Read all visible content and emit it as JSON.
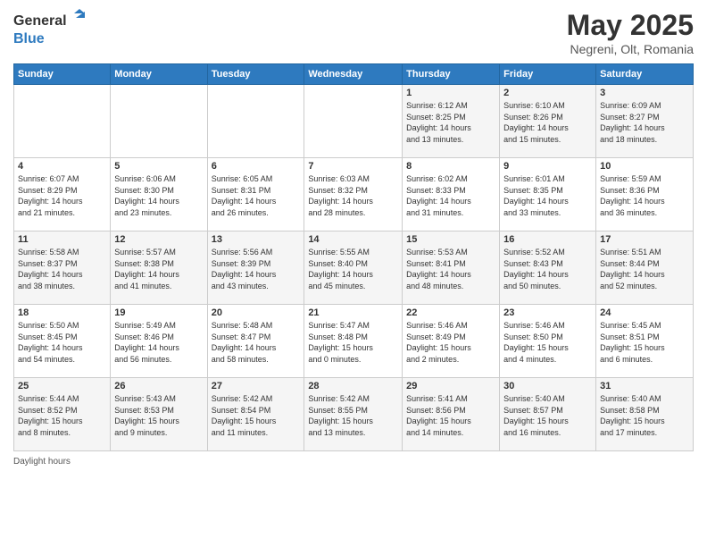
{
  "header": {
    "logo_line1": "General",
    "logo_line2": "Blue",
    "month_title": "May 2025",
    "location": "Negreni, Olt, Romania"
  },
  "days_of_week": [
    "Sunday",
    "Monday",
    "Tuesday",
    "Wednesday",
    "Thursday",
    "Friday",
    "Saturday"
  ],
  "weeks": [
    [
      {
        "day": "",
        "info": ""
      },
      {
        "day": "",
        "info": ""
      },
      {
        "day": "",
        "info": ""
      },
      {
        "day": "",
        "info": ""
      },
      {
        "day": "1",
        "info": "Sunrise: 6:12 AM\nSunset: 8:25 PM\nDaylight: 14 hours\nand 13 minutes."
      },
      {
        "day": "2",
        "info": "Sunrise: 6:10 AM\nSunset: 8:26 PM\nDaylight: 14 hours\nand 15 minutes."
      },
      {
        "day": "3",
        "info": "Sunrise: 6:09 AM\nSunset: 8:27 PM\nDaylight: 14 hours\nand 18 minutes."
      }
    ],
    [
      {
        "day": "4",
        "info": "Sunrise: 6:07 AM\nSunset: 8:29 PM\nDaylight: 14 hours\nand 21 minutes."
      },
      {
        "day": "5",
        "info": "Sunrise: 6:06 AM\nSunset: 8:30 PM\nDaylight: 14 hours\nand 23 minutes."
      },
      {
        "day": "6",
        "info": "Sunrise: 6:05 AM\nSunset: 8:31 PM\nDaylight: 14 hours\nand 26 minutes."
      },
      {
        "day": "7",
        "info": "Sunrise: 6:03 AM\nSunset: 8:32 PM\nDaylight: 14 hours\nand 28 minutes."
      },
      {
        "day": "8",
        "info": "Sunrise: 6:02 AM\nSunset: 8:33 PM\nDaylight: 14 hours\nand 31 minutes."
      },
      {
        "day": "9",
        "info": "Sunrise: 6:01 AM\nSunset: 8:35 PM\nDaylight: 14 hours\nand 33 minutes."
      },
      {
        "day": "10",
        "info": "Sunrise: 5:59 AM\nSunset: 8:36 PM\nDaylight: 14 hours\nand 36 minutes."
      }
    ],
    [
      {
        "day": "11",
        "info": "Sunrise: 5:58 AM\nSunset: 8:37 PM\nDaylight: 14 hours\nand 38 minutes."
      },
      {
        "day": "12",
        "info": "Sunrise: 5:57 AM\nSunset: 8:38 PM\nDaylight: 14 hours\nand 41 minutes."
      },
      {
        "day": "13",
        "info": "Sunrise: 5:56 AM\nSunset: 8:39 PM\nDaylight: 14 hours\nand 43 minutes."
      },
      {
        "day": "14",
        "info": "Sunrise: 5:55 AM\nSunset: 8:40 PM\nDaylight: 14 hours\nand 45 minutes."
      },
      {
        "day": "15",
        "info": "Sunrise: 5:53 AM\nSunset: 8:41 PM\nDaylight: 14 hours\nand 48 minutes."
      },
      {
        "day": "16",
        "info": "Sunrise: 5:52 AM\nSunset: 8:43 PM\nDaylight: 14 hours\nand 50 minutes."
      },
      {
        "day": "17",
        "info": "Sunrise: 5:51 AM\nSunset: 8:44 PM\nDaylight: 14 hours\nand 52 minutes."
      }
    ],
    [
      {
        "day": "18",
        "info": "Sunrise: 5:50 AM\nSunset: 8:45 PM\nDaylight: 14 hours\nand 54 minutes."
      },
      {
        "day": "19",
        "info": "Sunrise: 5:49 AM\nSunset: 8:46 PM\nDaylight: 14 hours\nand 56 minutes."
      },
      {
        "day": "20",
        "info": "Sunrise: 5:48 AM\nSunset: 8:47 PM\nDaylight: 14 hours\nand 58 minutes."
      },
      {
        "day": "21",
        "info": "Sunrise: 5:47 AM\nSunset: 8:48 PM\nDaylight: 15 hours\nand 0 minutes."
      },
      {
        "day": "22",
        "info": "Sunrise: 5:46 AM\nSunset: 8:49 PM\nDaylight: 15 hours\nand 2 minutes."
      },
      {
        "day": "23",
        "info": "Sunrise: 5:46 AM\nSunset: 8:50 PM\nDaylight: 15 hours\nand 4 minutes."
      },
      {
        "day": "24",
        "info": "Sunrise: 5:45 AM\nSunset: 8:51 PM\nDaylight: 15 hours\nand 6 minutes."
      }
    ],
    [
      {
        "day": "25",
        "info": "Sunrise: 5:44 AM\nSunset: 8:52 PM\nDaylight: 15 hours\nand 8 minutes."
      },
      {
        "day": "26",
        "info": "Sunrise: 5:43 AM\nSunset: 8:53 PM\nDaylight: 15 hours\nand 9 minutes."
      },
      {
        "day": "27",
        "info": "Sunrise: 5:42 AM\nSunset: 8:54 PM\nDaylight: 15 hours\nand 11 minutes."
      },
      {
        "day": "28",
        "info": "Sunrise: 5:42 AM\nSunset: 8:55 PM\nDaylight: 15 hours\nand 13 minutes."
      },
      {
        "day": "29",
        "info": "Sunrise: 5:41 AM\nSunset: 8:56 PM\nDaylight: 15 hours\nand 14 minutes."
      },
      {
        "day": "30",
        "info": "Sunrise: 5:40 AM\nSunset: 8:57 PM\nDaylight: 15 hours\nand 16 minutes."
      },
      {
        "day": "31",
        "info": "Sunrise: 5:40 AM\nSunset: 8:58 PM\nDaylight: 15 hours\nand 17 minutes."
      }
    ]
  ],
  "footer": {
    "daylight_label": "Daylight hours"
  }
}
